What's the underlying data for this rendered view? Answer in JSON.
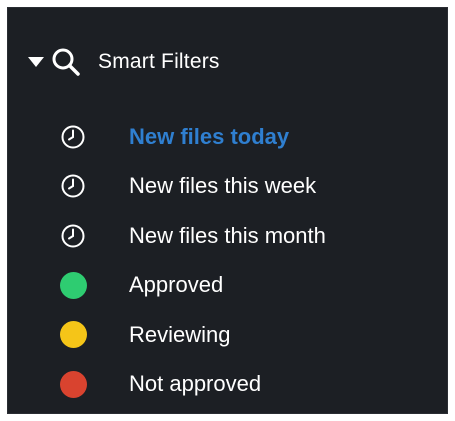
{
  "smart_filters": {
    "title": "Smart Filters",
    "expanded": true,
    "caret_icon": "caret-down-icon",
    "header_icon": "search-icon",
    "items": [
      {
        "label": "New files today",
        "icon": "clock-icon",
        "active": true
      },
      {
        "label": "New files this week",
        "icon": "clock-icon",
        "active": false
      },
      {
        "label": "New files this month",
        "icon": "clock-icon",
        "active": false
      },
      {
        "label": "Approved",
        "icon": "status-dot-icon",
        "color": "#2ecc71",
        "active": false
      },
      {
        "label": "Reviewing",
        "icon": "status-dot-icon",
        "color": "#f5c518",
        "active": false
      },
      {
        "label": "Not approved",
        "icon": "status-dot-icon",
        "color": "#d9432f",
        "active": false
      }
    ]
  },
  "colors": {
    "panel_background": "#1c1f24",
    "text": "#ffffff",
    "active_text": "#2f7fd0"
  }
}
